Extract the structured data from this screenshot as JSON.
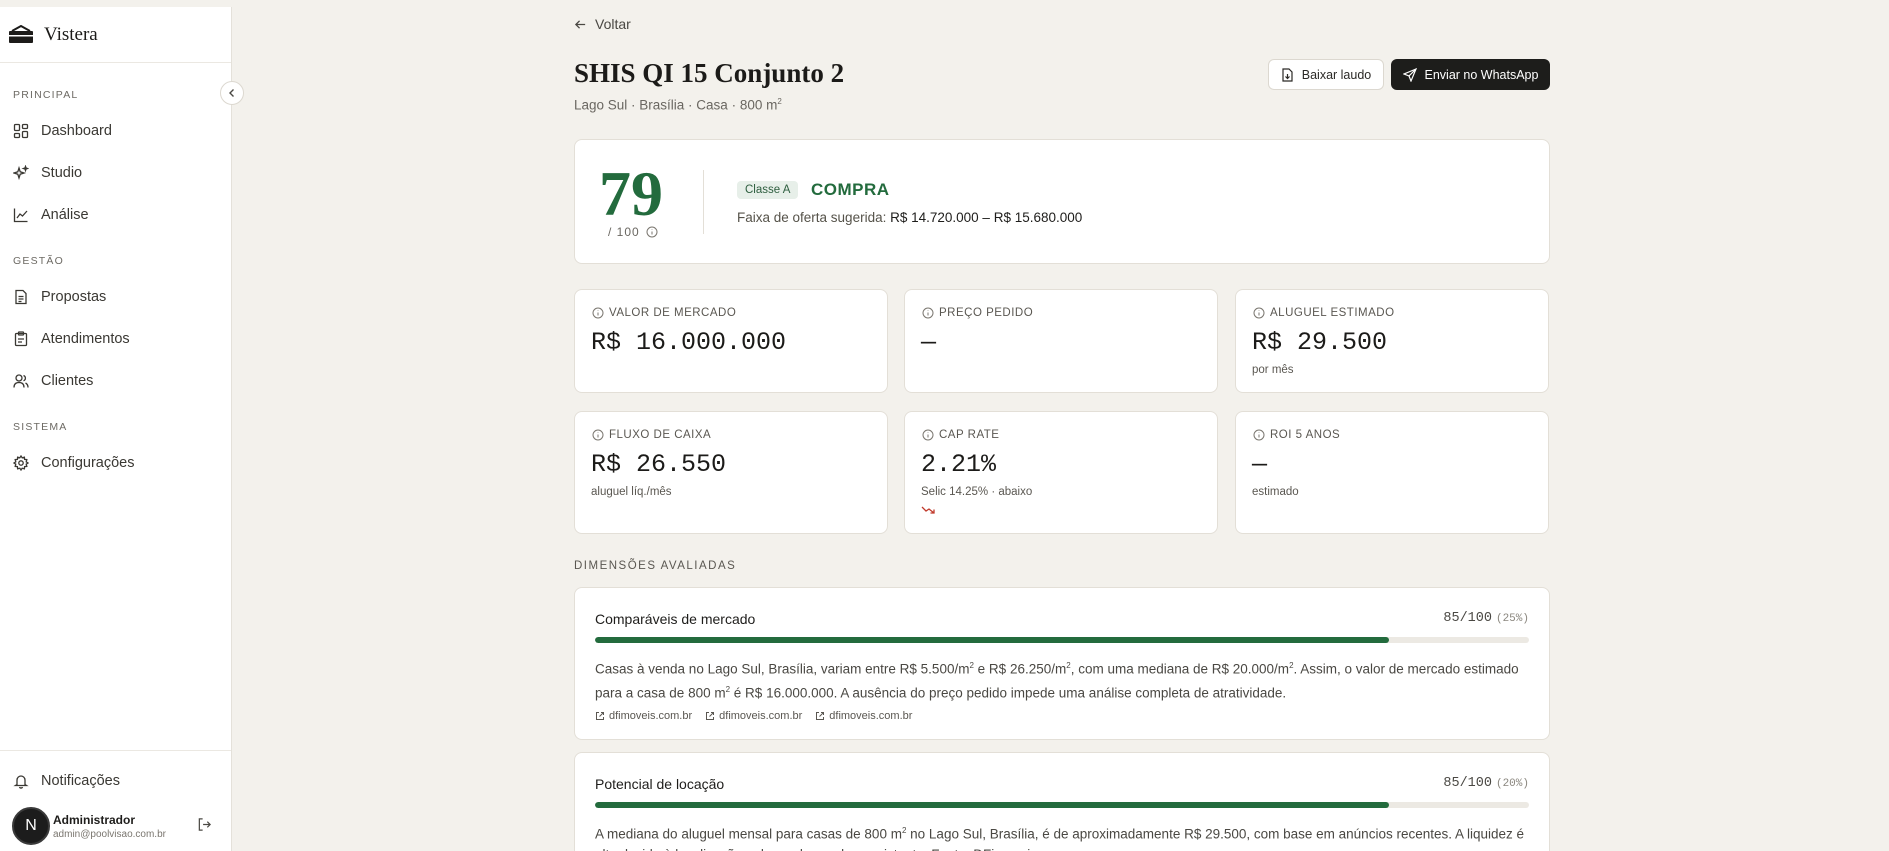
{
  "brand": {
    "name": "Vistera"
  },
  "sidebar": {
    "sections": [
      {
        "label": "PRINCIPAL"
      },
      {
        "label": "GESTÃO"
      },
      {
        "label": "SISTEMA"
      }
    ],
    "items": [
      {
        "label": "Dashboard",
        "icon": "dashboard-icon"
      },
      {
        "label": "Studio",
        "icon": "sparkles-icon"
      },
      {
        "label": "Análise",
        "icon": "chart-line-icon"
      },
      {
        "label": "Propostas",
        "icon": "document-icon"
      },
      {
        "label": "Atendimentos",
        "icon": "clipboard-icon"
      },
      {
        "label": "Clientes",
        "icon": "users-icon"
      },
      {
        "label": "Configurações",
        "icon": "gear-icon"
      }
    ],
    "notifications": "Notificações",
    "user": {
      "initial": "N",
      "name": "Administrador",
      "email": "admin@poolvisao.com.br"
    }
  },
  "header": {
    "back": "Voltar",
    "title": "SHIS QI 15 Conjunto 2",
    "subtitle_prefix": "Lago Sul · Brasília · Casa · 800 m",
    "subtitle_sup": "2",
    "download_label": "Baixar laudo",
    "whatsapp_label": "Enviar no WhatsApp"
  },
  "score": {
    "value": "79",
    "out_of": "/ 100",
    "class_badge": "Classe A",
    "verdict": "COMPRA",
    "offer_label": "Faixa de oferta sugerida:",
    "offer_range": "R$ 14.720.000 – R$ 15.680.000"
  },
  "metrics": [
    {
      "label": "VALOR DE MERCADO",
      "value": "R$ 16.000.000",
      "sub": ""
    },
    {
      "label": "PREÇO PEDIDO",
      "value": "—",
      "sub": ""
    },
    {
      "label": "ALUGUEL ESTIMADO",
      "value": "R$ 29.500",
      "sub": "por mês"
    },
    {
      "label": "FLUXO DE CAIXA",
      "value": "R$ 26.550",
      "sub": "aluguel líq./mês"
    },
    {
      "label": "CAP RATE",
      "value": "2.21%",
      "sub": "Selic 14.25% · abaixo"
    },
    {
      "label": "ROI 5 ANOS",
      "value": "—",
      "sub": "estimado"
    }
  ],
  "dimensions": {
    "label": "DIMENSÕES AVALIADAS",
    "items": [
      {
        "title": "Comparáveis de mercado",
        "score": "85/100",
        "weight": "(25%)",
        "progress": 0.85,
        "text_html": "Casas à venda no Lago Sul, Brasília, variam entre R$ 5.500/m<sup>2</sup> e R$ 26.250/m<sup>2</sup>, com uma mediana de R$ 20.000/m<sup>2</sup>. Assim, o valor de mercado estimado para a casa de 800 m<sup>2</sup> é R$ 16.000.000. A ausência do preço pedido impede uma análise completa de atratividade.",
        "sources": [
          "dfimoveis.com.br",
          "dfimoveis.com.br",
          "dfimoveis.com.br"
        ]
      },
      {
        "title": "Potencial de locação",
        "score": "85/100",
        "weight": "(20%)",
        "progress": 0.85,
        "text_html": "A mediana do aluguel mensal para casas de 800 m<sup>2</sup> no Lago Sul, Brasília, é de aproximadamente R$ 29.500, com base em anúncios recentes. A liquidez é alta devido à localização nobre e demanda consistente. Fonte: DFimoveis.",
        "sources": []
      }
    ]
  },
  "colors": {
    "accent": "#236b3d",
    "background": "#f3f1ec",
    "dark_button": "#1d1d1b",
    "trend_down": "#c0392b"
  }
}
